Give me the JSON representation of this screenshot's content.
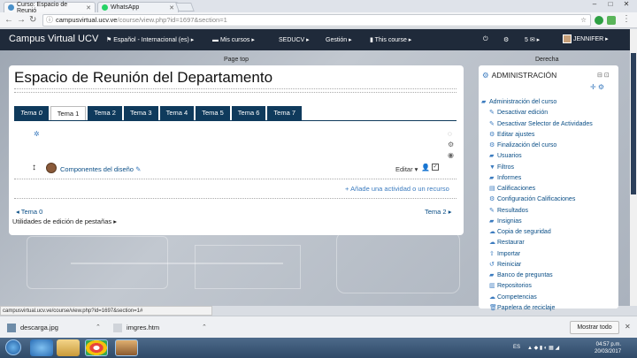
{
  "browser": {
    "tabs": [
      {
        "title": "Curso: Espacio de Reunió",
        "active": true,
        "favicon_color": "#4a90c8"
      },
      {
        "title": "WhatsApp",
        "active": false,
        "favicon_color": "#25d366"
      }
    ],
    "url_host": "campusvirtual.ucv.ve",
    "url_path": "/course/view.php?id=1697&section=1",
    "status_url": "campusvirtual.ucv.ve/course/view.php?id=1697&section=1#"
  },
  "moodle_nav": {
    "brand": "Campus Virtual UCV",
    "items": [
      "Español - Internacional (es)",
      "Mis cursos",
      "SEDUCV",
      "Gestión",
      "This course"
    ],
    "notifications_count": "5",
    "user": "JENNIFER"
  },
  "labels": {
    "page_top": "Page top",
    "derecha": "Derecha"
  },
  "main": {
    "title": "Espacio de Reunión del Departamento",
    "tabs": [
      "Tema 0",
      "Tema 1",
      "Tema 2",
      "Tema 3",
      "Tema 4",
      "Tema 5",
      "Tema 6",
      "Tema 7"
    ],
    "selected_tab": "Tema 1",
    "activity": "Componentes del diseño",
    "edit_menu": "Editar",
    "add_activity": "Añade una actividad o un recurso",
    "prev_section": "Tema 0",
    "next_section": "Tema 2",
    "tab_utilities": "Utilidades de edición de pestañas"
  },
  "admin": {
    "title": "ADMINISTRACIÓN",
    "root": "Administración del curso",
    "items": [
      {
        "label": "Desactivar edición",
        "icon": "pencil-icon"
      },
      {
        "label": "Desactivar Selector de Actividades",
        "icon": "pencil-icon"
      },
      {
        "label": "Editar ajustes",
        "icon": "gear-icon"
      },
      {
        "label": "Finalización del curso",
        "icon": "gear-icon"
      },
      {
        "label": "Usuarios",
        "icon": "folder-icon"
      },
      {
        "label": "Filtros",
        "icon": "filter-icon"
      },
      {
        "label": "Informes",
        "icon": "folder-icon"
      },
      {
        "label": "Calificaciones",
        "icon": "grades-icon"
      },
      {
        "label": "Configuración Calificaciones",
        "icon": "gear-icon"
      },
      {
        "label": "Resultados",
        "icon": "pencil-icon"
      },
      {
        "label": "Insignias",
        "icon": "folder-icon"
      },
      {
        "label": "Copia de seguridad",
        "icon": "cloud-download-icon"
      },
      {
        "label": "Restaurar",
        "icon": "cloud-upload-icon"
      },
      {
        "label": "Importar",
        "icon": "upload-icon"
      },
      {
        "label": "Reiniciar",
        "icon": "reset-icon"
      },
      {
        "label": "Banco de preguntas",
        "icon": "folder-icon"
      },
      {
        "label": "Repositorios",
        "icon": "repository-icon"
      },
      {
        "label": "Competencias",
        "icon": "cloud-icon"
      },
      {
        "label": "Papelera de reciclaje",
        "icon": "trash-icon"
      }
    ]
  },
  "downloads": {
    "files": [
      "descarga.jpg",
      "imgres.htm"
    ],
    "show_all": "Mostrar todo"
  },
  "taskbar": {
    "language": "ES",
    "time": "04:57 p.m.",
    "date": "20/03/2017"
  },
  "colors": {
    "moodle_nav": "#1f2a3a",
    "tab_bg": "#0f3a5c",
    "link": "#0a4e86",
    "accent": "#3b7bbf"
  }
}
